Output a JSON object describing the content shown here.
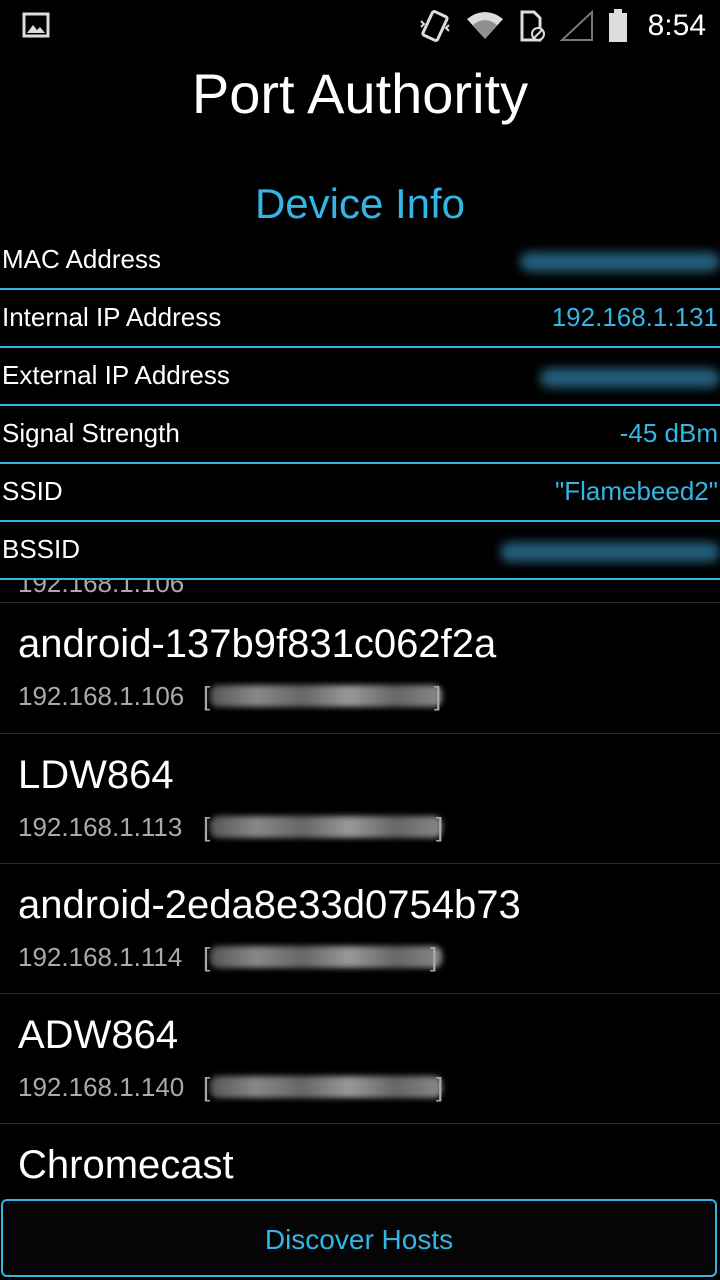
{
  "status_bar": {
    "time": "8:54",
    "icons": [
      "image-icon",
      "vibrate-icon",
      "wifi-icon",
      "sim-icon",
      "cell-signal-icon",
      "battery-icon"
    ]
  },
  "app": {
    "title": "Port Authority"
  },
  "device_info": {
    "heading": "Device Info",
    "rows": [
      {
        "label": "MAC Address",
        "value": "",
        "redacted": true
      },
      {
        "label": "Internal IP Address",
        "value": "192.168.1.131",
        "redacted": false
      },
      {
        "label": "External IP Address",
        "value": "",
        "redacted": true
      },
      {
        "label": "Signal Strength",
        "value": "-45 dBm",
        "redacted": false
      },
      {
        "label": "SSID",
        "value": "\"Flamebeed2\"",
        "redacted": false
      },
      {
        "label": "BSSID",
        "value": "",
        "redacted": true
      }
    ]
  },
  "hosts": [
    {
      "name": "android-137b9f831c062f2a",
      "ip": "192.168.1.106"
    },
    {
      "name": "LDW864",
      "ip": "192.168.1.113"
    },
    {
      "name": "android-2eda8e33d0754b73",
      "ip": "192.168.1.114"
    },
    {
      "name": "ADW864",
      "ip": "192.168.1.140"
    },
    {
      "name": "Chromecast",
      "ip": ""
    }
  ],
  "actions": {
    "discover_label": "Discover Hosts"
  },
  "colors": {
    "accent": "#33b5e5",
    "background": "#000000",
    "secondary_text": "#aaaaaa"
  }
}
